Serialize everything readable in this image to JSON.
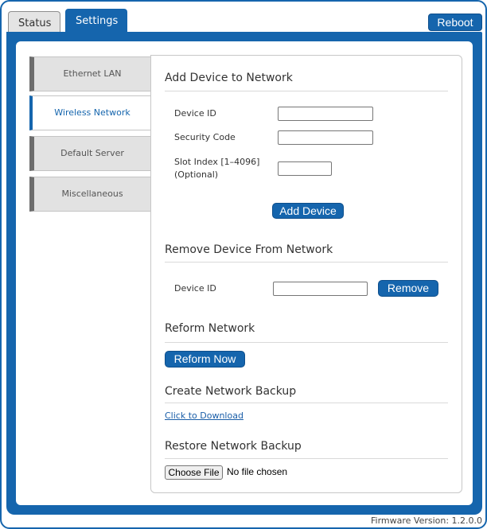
{
  "tabs": [
    {
      "label": "Status"
    },
    {
      "label": "Settings"
    }
  ],
  "reboot_label": "Reboot",
  "nav": [
    {
      "label": "Ethernet LAN"
    },
    {
      "label": "Wireless Network"
    },
    {
      "label": "Default Server"
    },
    {
      "label": "Miscellaneous"
    }
  ],
  "add": {
    "title": "Add Device to Network",
    "device_id_label": "Device ID",
    "device_id_value": "",
    "security_code_label": "Security Code",
    "security_code_value": "",
    "slot_index_label_1": "Slot Index [1–4096]",
    "slot_index_label_2": "(Optional)",
    "slot_index_value": "",
    "button": "Add Device"
  },
  "remove": {
    "title": "Remove Device From Network",
    "device_id_label": "Device ID",
    "device_id_value": "",
    "button": "Remove"
  },
  "reform": {
    "title": "Reform Network",
    "button": "Reform Now"
  },
  "backup": {
    "title": "Create Network Backup",
    "link": "Click to Download"
  },
  "restore": {
    "title": "Restore Network Backup",
    "choose_button": "Choose File",
    "status": "No file chosen"
  },
  "footer": {
    "firmware": "Firmware Version: 1.2.0.0"
  },
  "colors": {
    "accent": "#1565ad",
    "nav_inactive": "#e2e2e2"
  }
}
